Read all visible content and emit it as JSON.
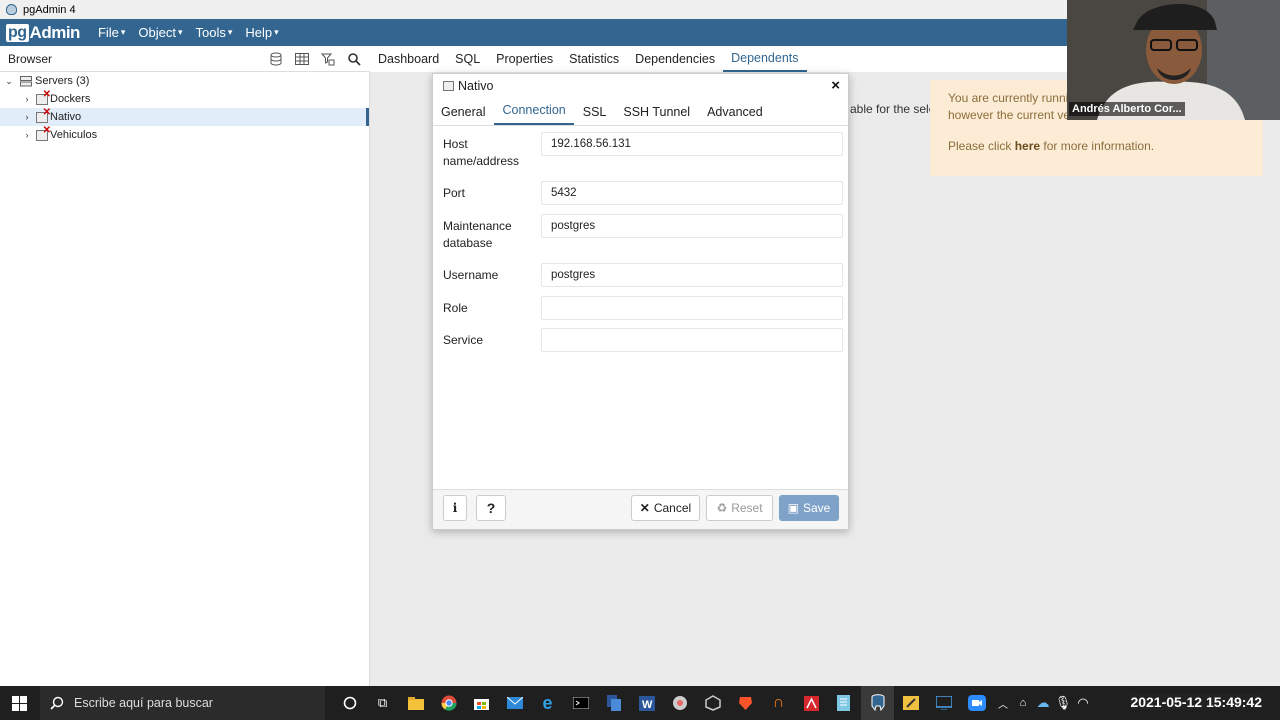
{
  "window": {
    "title": "pgAdmin 4"
  },
  "menubar": {
    "logo": {
      "pg": "pg",
      "rest": "Admin"
    },
    "items": [
      "File",
      "Object",
      "Tools",
      "Help"
    ]
  },
  "browser": {
    "title": "Browser",
    "tree": [
      {
        "label": "Servers (3)",
        "level": 0
      },
      {
        "label": "Dockers",
        "level": 1
      },
      {
        "label": "Nativo",
        "level": 1,
        "selected": true
      },
      {
        "label": "Vehiculos",
        "level": 1
      }
    ]
  },
  "main_tabs": [
    "Dashboard",
    "SQL",
    "Properties",
    "Statistics",
    "Dependencies",
    "Dependents"
  ],
  "main_tabs_active": "Dependents",
  "background_text": "able for the sele",
  "alert": {
    "line1": "You are currently runni",
    "line2": "however the current ve",
    "click_prefix": "Please click ",
    "click_link": "here",
    "click_suffix": " for more information."
  },
  "dialog": {
    "title": "Nativo",
    "tabs": [
      "General",
      "Connection",
      "SSL",
      "SSH Tunnel",
      "Advanced"
    ],
    "active_tab": "Connection",
    "fields": {
      "host": {
        "label_line1": "Host",
        "label_line2": "name/address",
        "value": "192.168.56.131"
      },
      "port": {
        "label": "Port",
        "value": "5432"
      },
      "maintenance_db": {
        "label_line1": "Maintenance",
        "label_line2": "database",
        "value": "postgres"
      },
      "username": {
        "label": "Username",
        "value": "postgres"
      },
      "role": {
        "label": "Role",
        "value": ""
      },
      "service": {
        "label": "Service",
        "value": ""
      }
    },
    "buttons": {
      "info": "i",
      "help": "?",
      "cancel": "Cancel",
      "reset": "Reset",
      "save": "Save"
    }
  },
  "webcam": {
    "name": "Andrés Alberto Cor..."
  },
  "taskbar": {
    "search_placeholder": "Escribe aquí para buscar",
    "clock": "2021-05-12 15:49:42"
  },
  "colors": {
    "brand": "#326690",
    "alert_bg": "#fdecd5",
    "save_btn": "#7ea2c8"
  }
}
